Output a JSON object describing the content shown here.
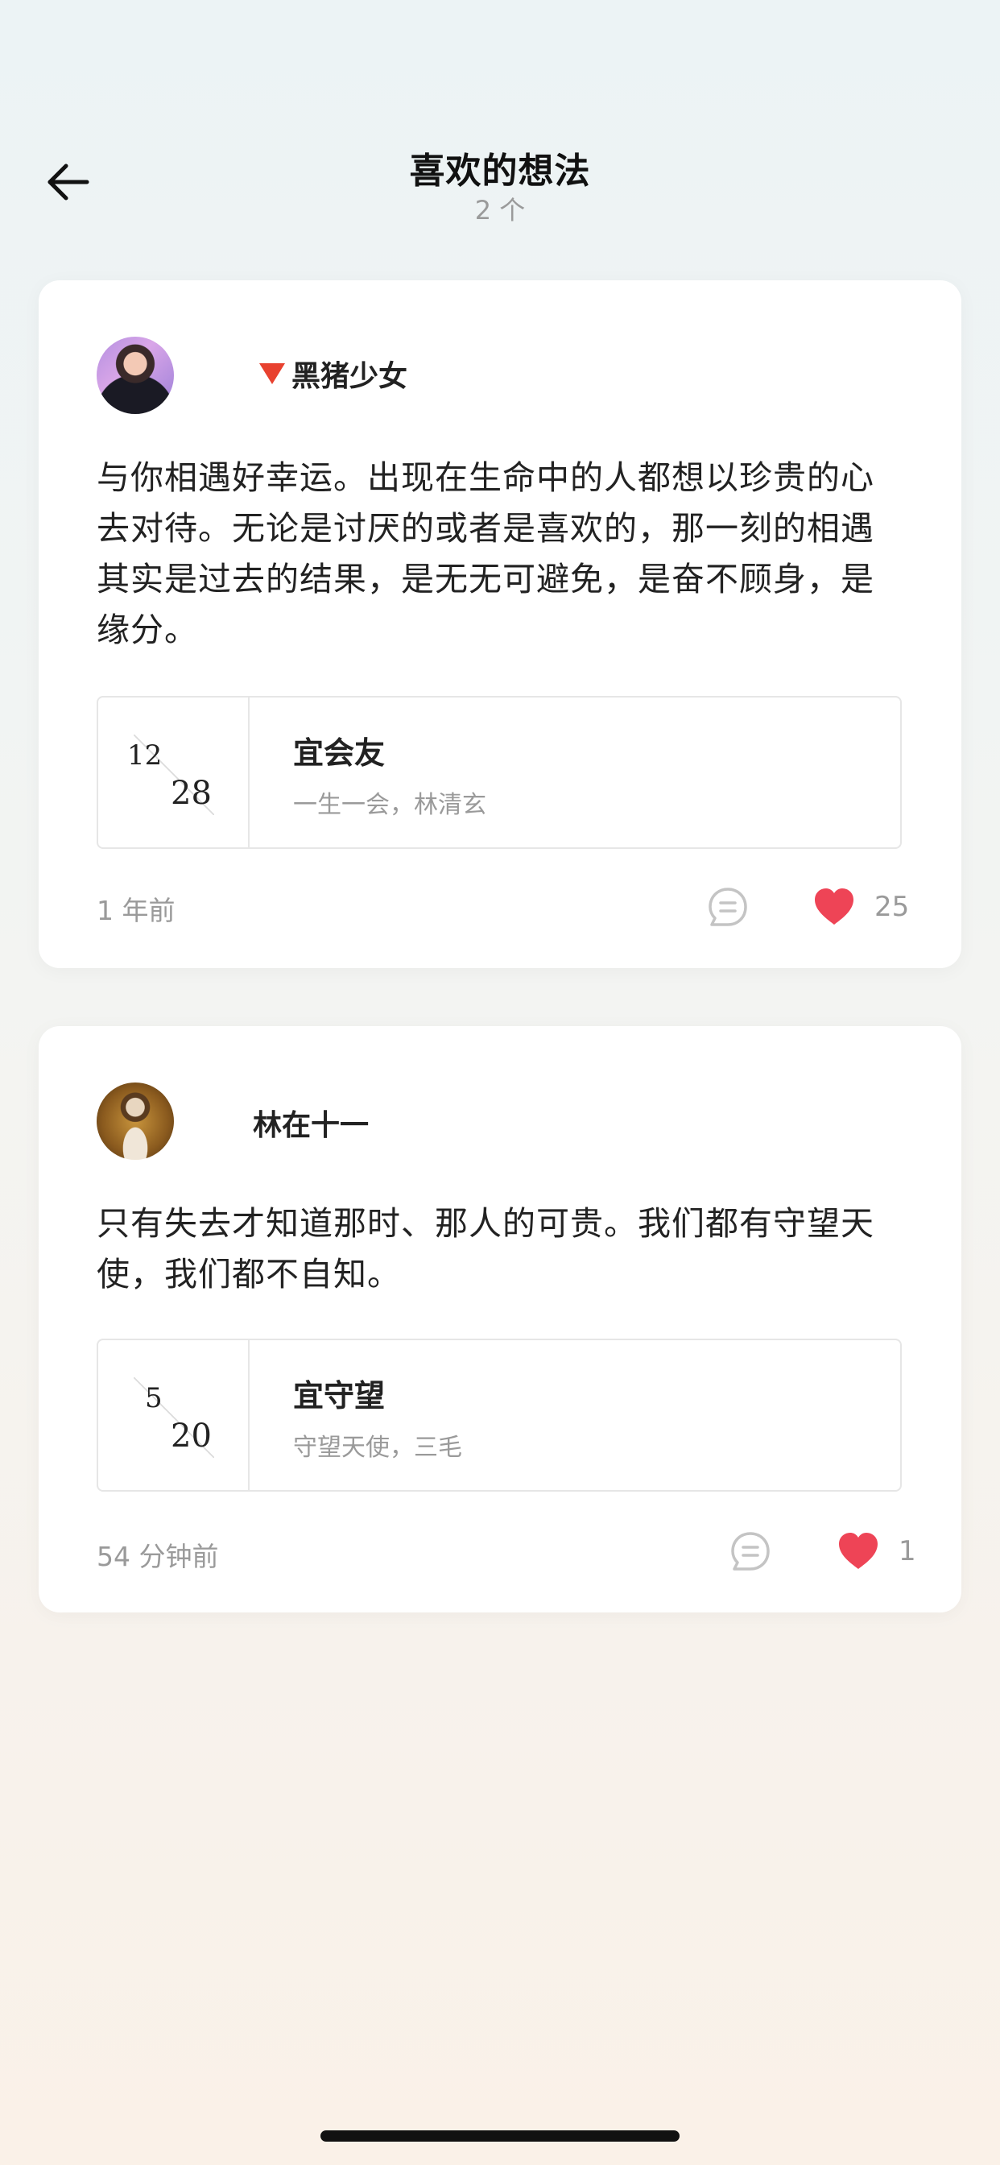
{
  "header": {
    "title": "喜欢的想法",
    "subtitle": "2 个",
    "back_icon": "arrow-left-icon"
  },
  "posts": [
    {
      "username": "黑猪少女",
      "username_prefix_icon": "red-triangle-icon",
      "content": "与你相遇好幸运。出现在生命中的人都想以珍贵的心去对待。无论是讨厌的或者是喜欢的，那一刻的相遇其实是过去的结果，是无无可避免，是奋不顾身，是缘分。",
      "quote": {
        "month": "12",
        "day": "28",
        "title": "宜会友",
        "source": "一生一会，林清玄"
      },
      "time_ago": "1 年前",
      "likes": "25",
      "liked": true
    },
    {
      "username": "林在十一",
      "content": "只有失去才知道那时、那人的可贵。我们都有守望天使，我们都不自知。",
      "quote": {
        "month": "5",
        "day": "20",
        "title": "宜守望",
        "source": "守望天使，三毛"
      },
      "time_ago": "54 分钟前",
      "likes": "1",
      "liked": true
    }
  ],
  "colors": {
    "heart": "#ee4456",
    "accent_triangle": "#e8412f",
    "muted_text": "#9a9a9a"
  }
}
